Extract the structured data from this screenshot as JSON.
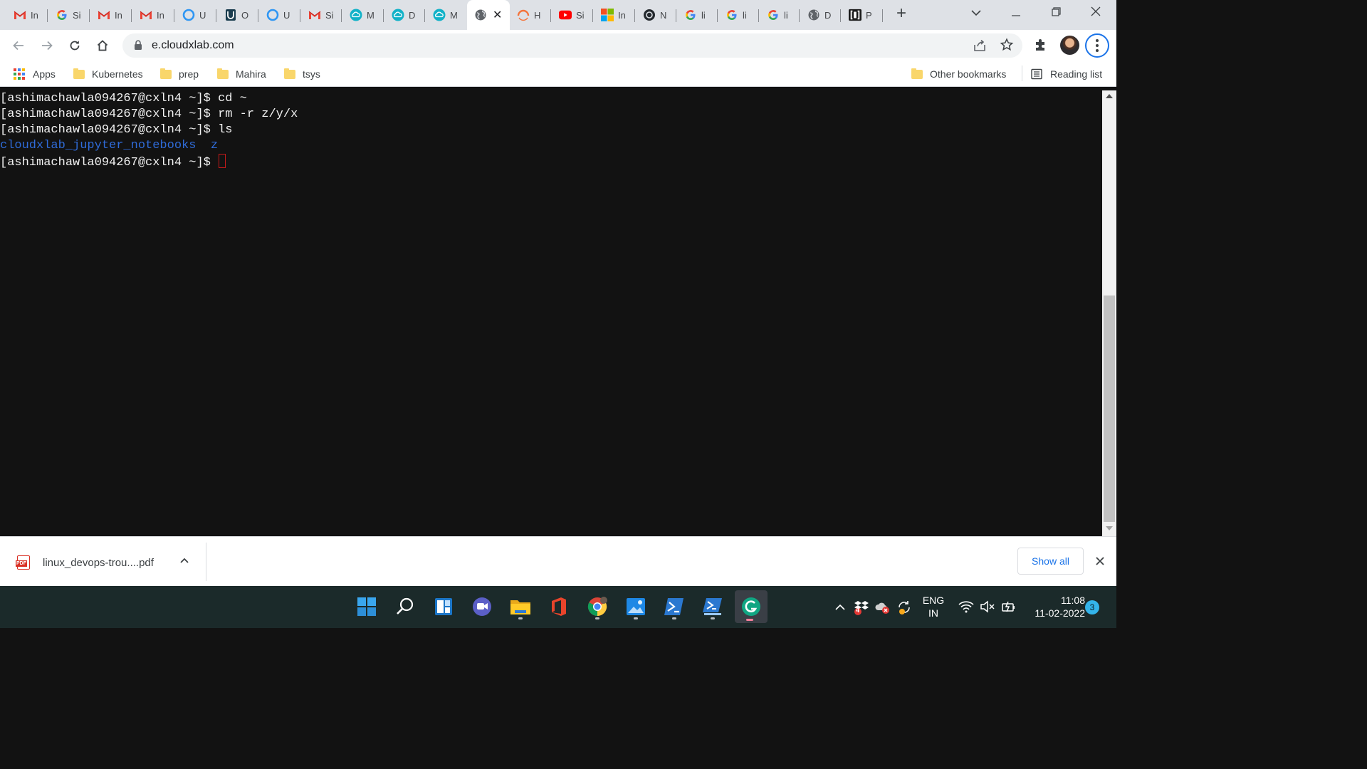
{
  "browser": {
    "tabs": [
      {
        "title": "In",
        "icon": "gmail-icon"
      },
      {
        "title": "Si",
        "icon": "google-icon"
      },
      {
        "title": "In",
        "icon": "gmail-icon"
      },
      {
        "title": "In",
        "icon": "gmail-icon"
      },
      {
        "title": "U",
        "icon": "ring-icon"
      },
      {
        "title": "O",
        "icon": "shield-icon"
      },
      {
        "title": "U",
        "icon": "ring-icon"
      },
      {
        "title": "Si",
        "icon": "gmail-icon"
      },
      {
        "title": "M",
        "icon": "cloud-icon"
      },
      {
        "title": "D",
        "icon": "cloud-icon"
      },
      {
        "title": "M",
        "icon": "cloud-icon"
      },
      {
        "title": "",
        "icon": "globe-icon",
        "active": true
      },
      {
        "title": "H",
        "icon": "arc-icon"
      },
      {
        "title": "Si",
        "icon": "youtube-icon"
      },
      {
        "title": "In",
        "icon": "microsoft-icon"
      },
      {
        "title": "N",
        "icon": "github-icon"
      },
      {
        "title": "li",
        "icon": "google-icon"
      },
      {
        "title": "li",
        "icon": "google-icon"
      },
      {
        "title": "li",
        "icon": "google-icon"
      },
      {
        "title": "D",
        "icon": "globe-icon"
      },
      {
        "title": "P",
        "icon": "bracket-icon"
      }
    ],
    "new_tab": "+",
    "address": "e.cloudxlab.com"
  },
  "bookmarks": {
    "apps": "Apps",
    "items": [
      "Kubernetes",
      "prep",
      "Mahira",
      "tsys"
    ],
    "other": "Other bookmarks",
    "reading_list": "Reading list"
  },
  "terminal": {
    "lines": [
      {
        "prompt": "[ashimachawla094267@cxln4 ~]$ ",
        "cmd": "cd ~"
      },
      {
        "prompt": "[ashimachawla094267@cxln4 ~]$ ",
        "cmd": "rm -r z/y/x"
      },
      {
        "prompt": "[ashimachawla094267@cxln4 ~]$ ",
        "cmd": "ls"
      },
      {
        "output": [
          "cloudxlab_jupyter_notebooks",
          "z"
        ]
      },
      {
        "prompt": "[ashimachawla094267@cxln4 ~]$ ",
        "cmd": "",
        "cursor": true
      }
    ],
    "colors": {
      "text": "#f2f2f2",
      "directory": "#2f6bd8",
      "cursor": "#c51a1a"
    }
  },
  "downloads": {
    "file": "linux_devops-trou....pdf",
    "file_badge": "PDF",
    "show_all": "Show all"
  },
  "taskbar": {
    "apps": [
      "windows-start-icon",
      "search-icon",
      "widgets-icon",
      "chat-icon",
      "file-explorer-icon",
      "office-icon",
      "chrome-icon",
      "photos-icon",
      "powershell-icon",
      "terminal-admin-icon",
      "grammarly-icon"
    ],
    "language_line1": "ENG",
    "language_line2": "IN",
    "time": "11:08",
    "date": "11-02-2022",
    "notifications": "3",
    "tray_badge": "4"
  }
}
